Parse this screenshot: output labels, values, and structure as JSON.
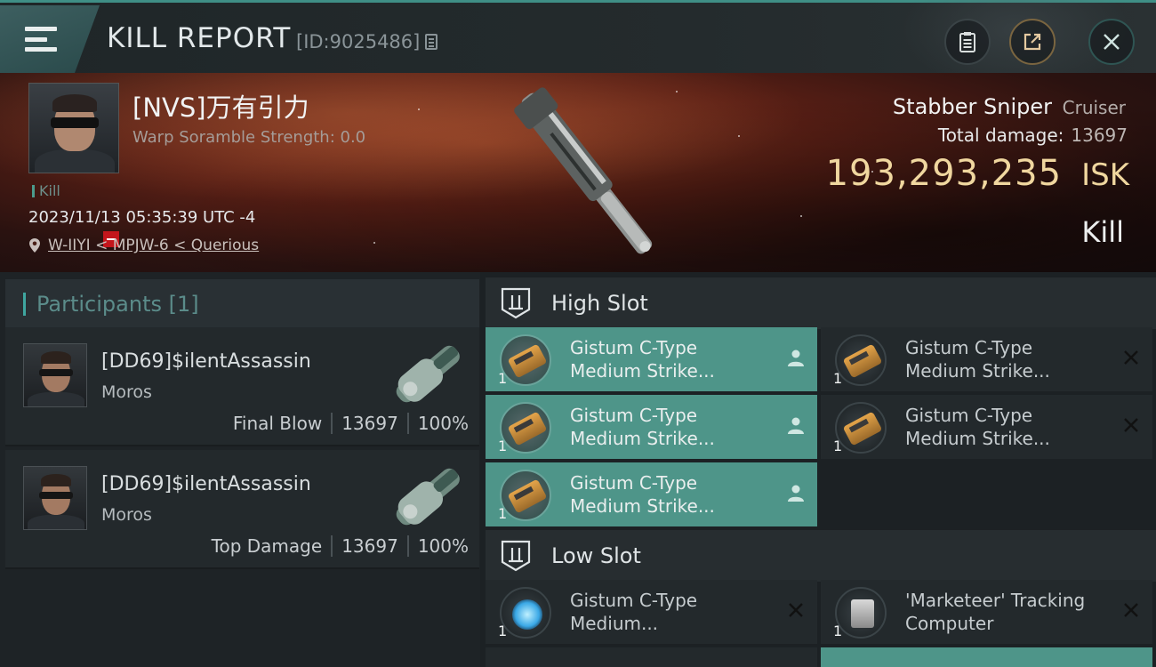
{
  "header": {
    "title": "KILL REPORT",
    "report_id": "[ID:9025486]"
  },
  "victim": {
    "name": "[NVS]万有引力",
    "warp_scramble": "Warp Soramble Strength: 0.0",
    "kill_tag": "Kill",
    "timestamp": "2023/11/13 05:35:39 UTC -4",
    "location": "W-IIYI < MPJW-6 < Querious",
    "ship_name": "Stabber Sniper",
    "ship_class": "Cruiser",
    "total_damage_label": "Total damage:",
    "total_damage": "13697",
    "isk_value": "193,293,235",
    "isk_unit": "ISK",
    "result_label": "Kill"
  },
  "participants": {
    "header": "Participants [1]",
    "rows": [
      {
        "name": "[DD69]$ilentAssassin",
        "ship": "Moros",
        "role": "Final Blow",
        "damage": "13697",
        "percent": "100%"
      },
      {
        "name": "[DD69]$ilentAssassin",
        "ship": "Moros",
        "role": "Top Damage",
        "damage": "13697",
        "percent": "100%"
      }
    ]
  },
  "fitting": {
    "high_slot_label": "High Slot",
    "low_slot_label": "Low Slot",
    "high_slots": [
      {
        "line1": "Gistum C-Type",
        "line2": "Medium Strike...",
        "qty": "1",
        "status": "fitted"
      },
      {
        "line1": "Gistum C-Type",
        "line2": "Medium Strike...",
        "qty": "1",
        "status": "destroyed"
      },
      {
        "line1": "Gistum C-Type",
        "line2": "Medium Strike...",
        "qty": "1",
        "status": "fitted"
      },
      {
        "line1": "Gistum C-Type",
        "line2": "Medium Strike...",
        "qty": "1",
        "status": "destroyed"
      },
      {
        "line1": "Gistum C-Type",
        "line2": "Medium Strike...",
        "qty": "1",
        "status": "fitted"
      }
    ],
    "low_slots": [
      {
        "line1": "Gistum C-Type",
        "line2": "Medium...",
        "qty": "1",
        "status": "destroyed"
      },
      {
        "line1": "'Marketeer' Tracking",
        "line2": "Computer",
        "qty": "1",
        "status": "destroyed"
      }
    ]
  },
  "colors": {
    "accent": "#4e9589",
    "isk": "#f0d79f",
    "badge": "#c3161c"
  }
}
